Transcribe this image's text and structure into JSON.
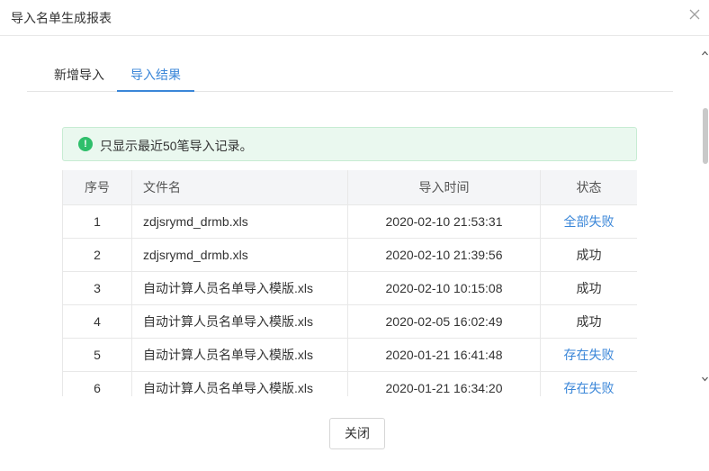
{
  "dialog": {
    "title": "导入名单生成报表"
  },
  "tabs": [
    {
      "label": "新增导入",
      "active": false
    },
    {
      "label": "导入结果",
      "active": true
    }
  ],
  "notice": {
    "icon": "!",
    "text": "只显示最近50笔导入记录。"
  },
  "table": {
    "headers": {
      "index": "序号",
      "filename": "文件名",
      "time": "导入时间",
      "status": "状态"
    },
    "rows": [
      {
        "index": "1",
        "filename": "zdjsrymd_drmb.xls",
        "time": "2020-02-10 21:53:31",
        "status": "全部失败",
        "link": true
      },
      {
        "index": "2",
        "filename": "zdjsrymd_drmb.xls",
        "time": "2020-02-10 21:39:56",
        "status": "成功",
        "link": false
      },
      {
        "index": "3",
        "filename": "自动计算人员名单导入模版.xls",
        "time": "2020-02-10 10:15:08",
        "status": "成功",
        "link": false
      },
      {
        "index": "4",
        "filename": "自动计算人员名单导入模版.xls",
        "time": "2020-02-05 16:02:49",
        "status": "成功",
        "link": false
      },
      {
        "index": "5",
        "filename": "自动计算人员名单导入模版.xls",
        "time": "2020-01-21 16:41:48",
        "status": "存在失败",
        "link": true
      },
      {
        "index": "6",
        "filename": "自动计算人员名单导入模版.xls",
        "time": "2020-01-21 16:34:20",
        "status": "存在失败",
        "link": true
      }
    ]
  },
  "footer": {
    "close_label": "关闭"
  },
  "colors": {
    "accent": "#3a86d8",
    "success": "#2fbf6b",
    "notice_bg": "#eaf8ef"
  }
}
